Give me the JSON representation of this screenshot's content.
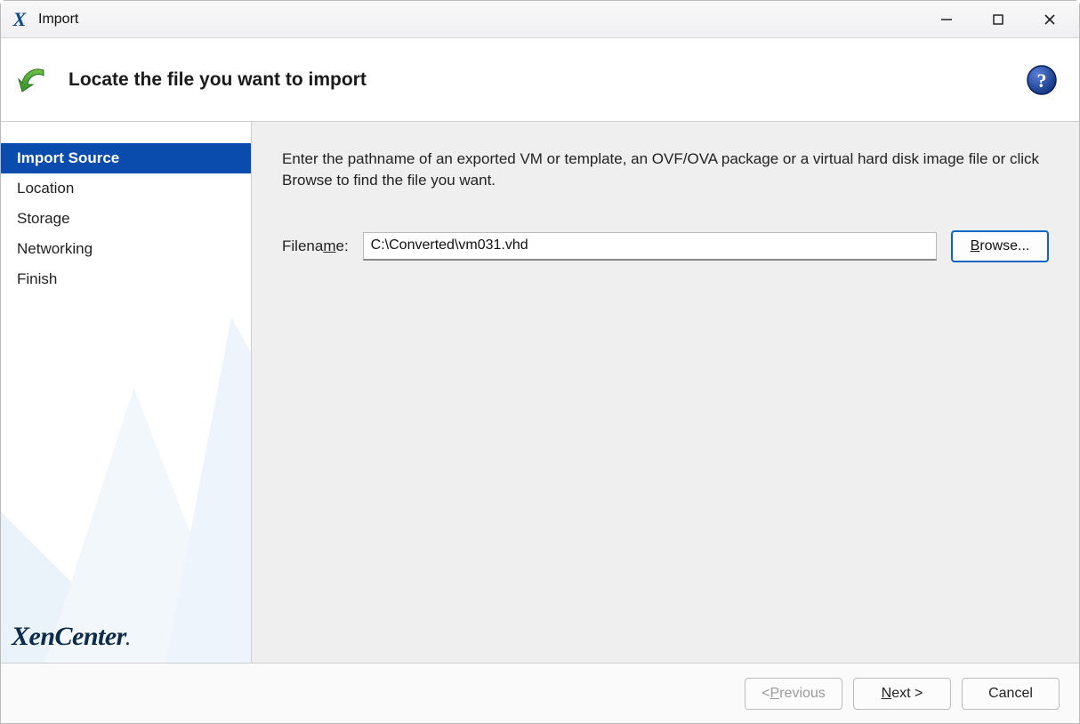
{
  "window": {
    "title": "Import"
  },
  "banner": {
    "heading": "Locate the file you want to import"
  },
  "sidebar": {
    "items": [
      {
        "label": "Import Source",
        "active": true
      },
      {
        "label": "Location",
        "active": false
      },
      {
        "label": "Storage",
        "active": false
      },
      {
        "label": "Networking",
        "active": false
      },
      {
        "label": "Finish",
        "active": false
      }
    ],
    "brand": "XenCenter"
  },
  "content": {
    "instruction": "Enter the pathname of an exported VM or template, an OVF/OVA package or a virtual hard disk image file or click Browse to find the file you want.",
    "filename_label_pre": "Filena",
    "filename_label_u": "m",
    "filename_label_post": "e:",
    "filename_value": "C:\\Converted\\vm031.vhd",
    "browse_u": "B",
    "browse_rest": "rowse..."
  },
  "footer": {
    "prev_pre": "< ",
    "prev_u": "P",
    "prev_post": "revious",
    "next_u": "N",
    "next_post": "ext >",
    "cancel": "Cancel"
  }
}
